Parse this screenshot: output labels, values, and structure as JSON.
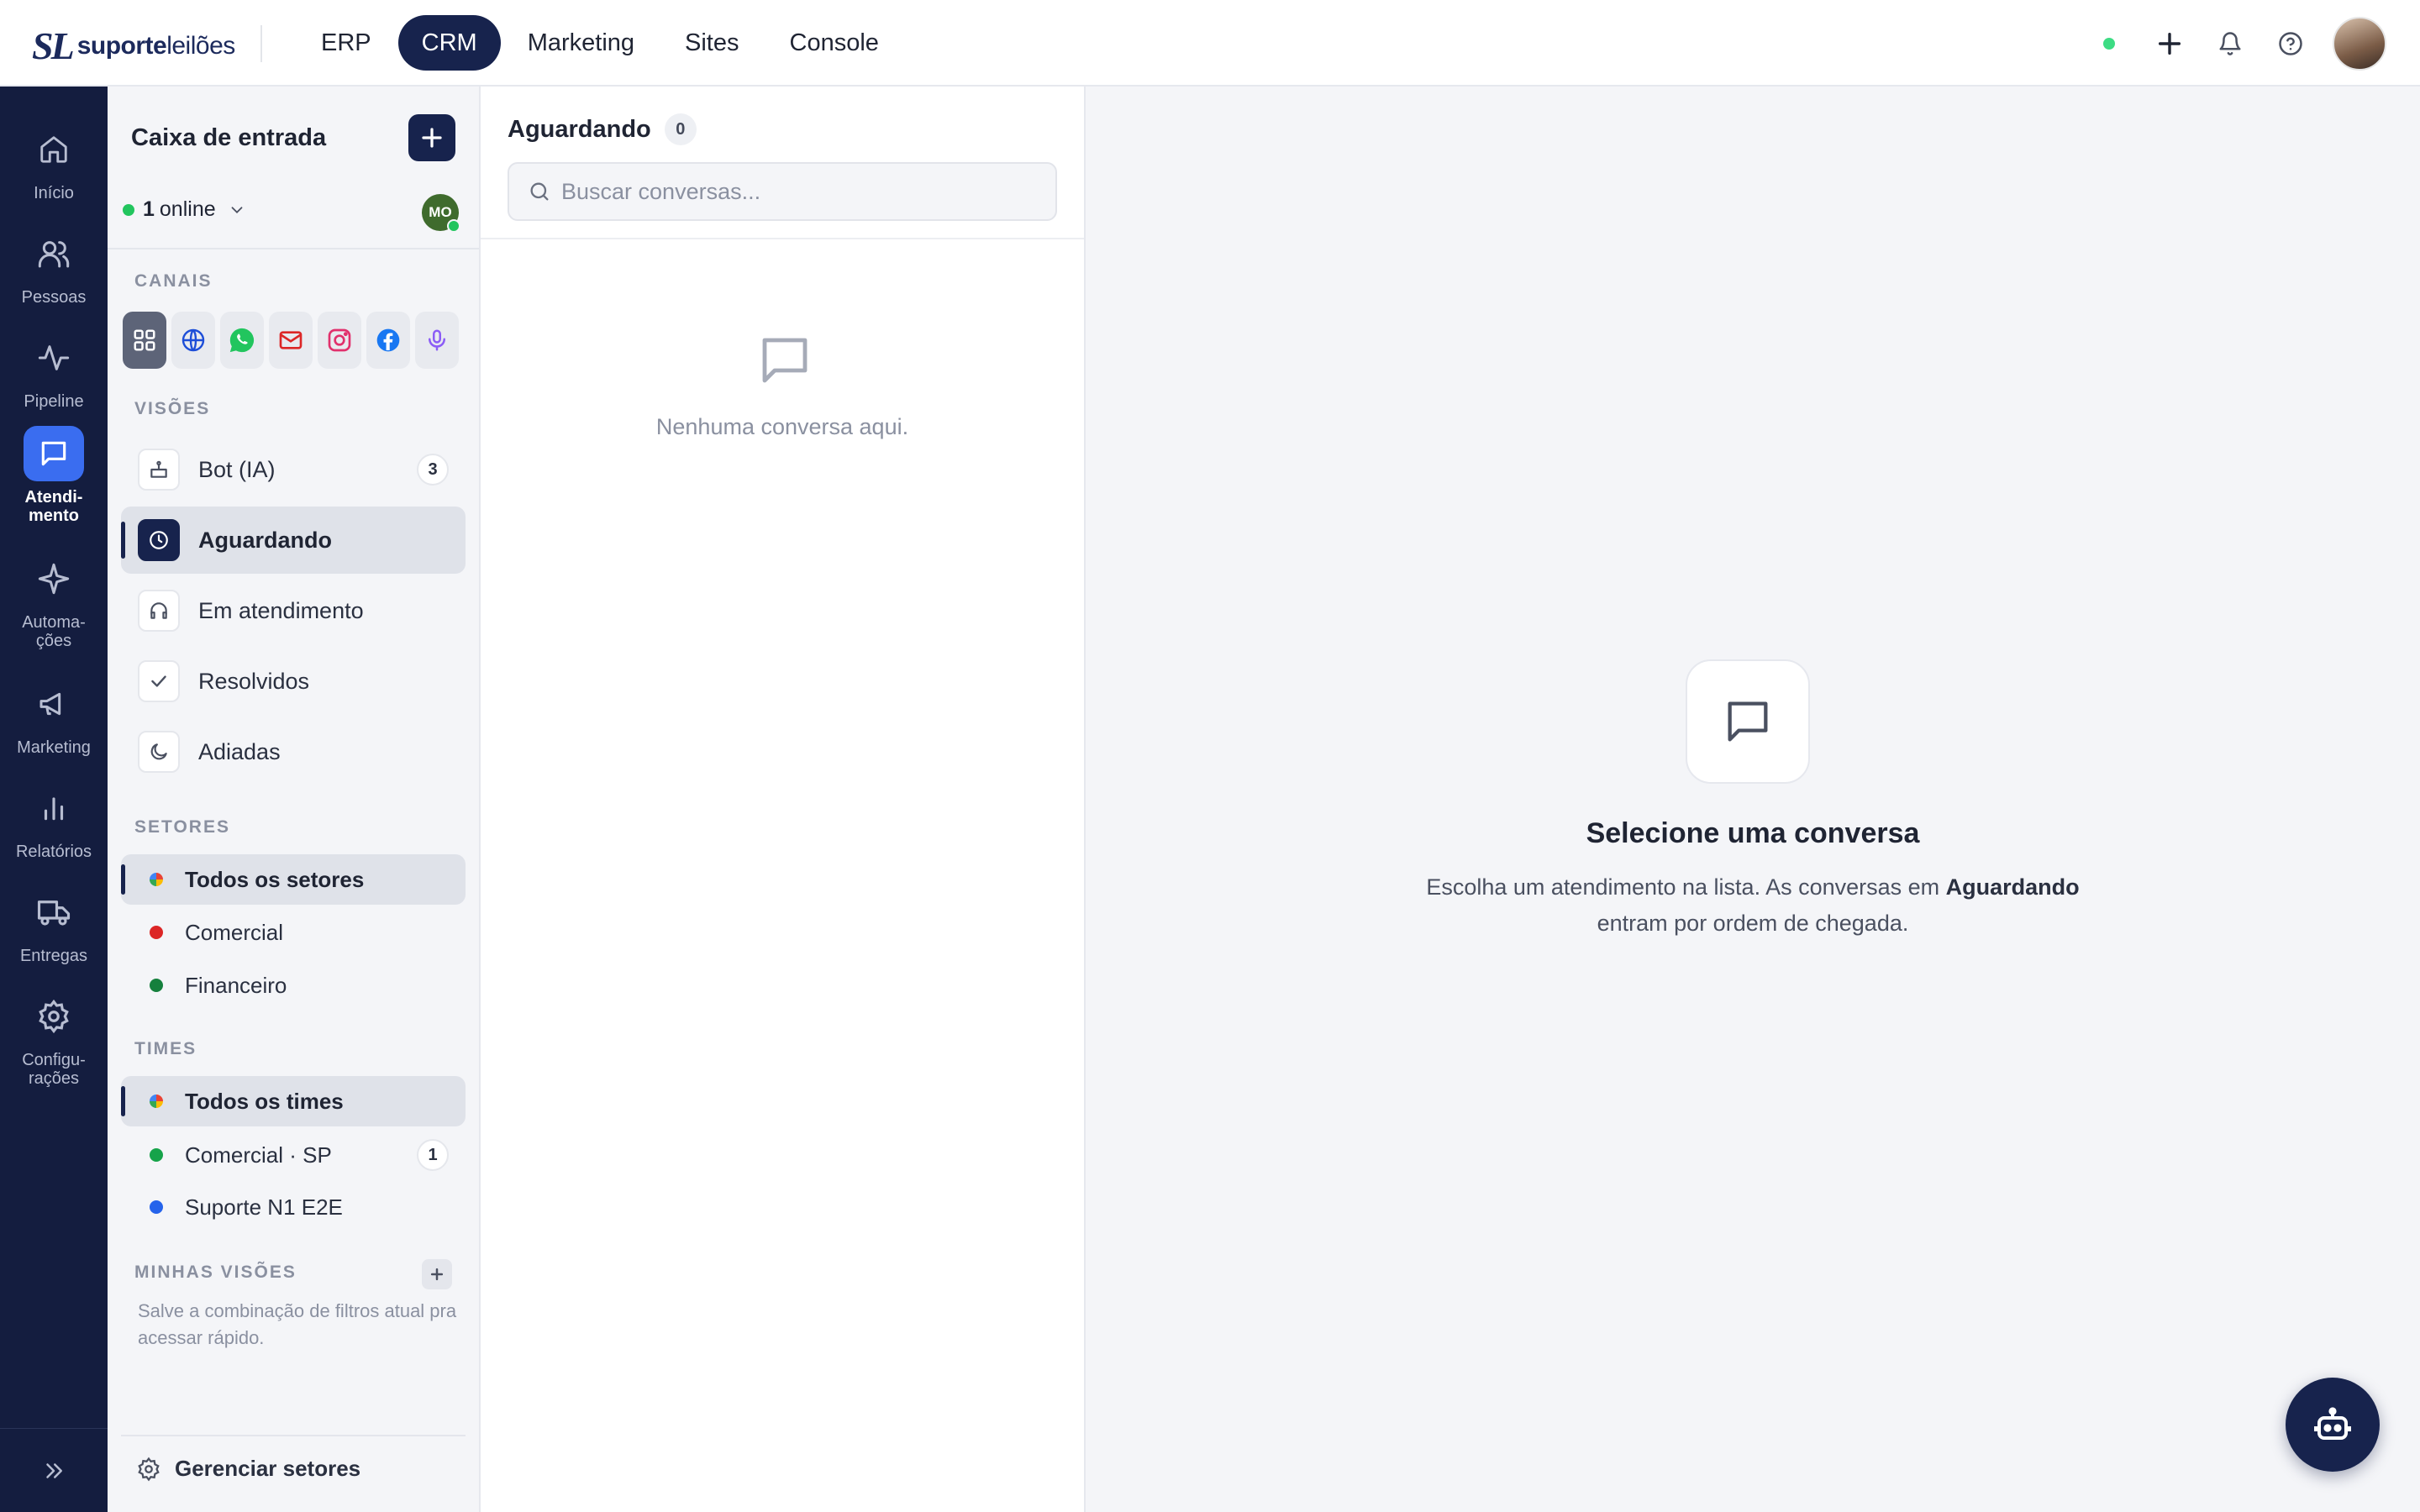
{
  "brand": {
    "mark": "SL",
    "word_bold": "suporte",
    "word_light": "leilões"
  },
  "topnav": [
    {
      "label": "ERP"
    },
    {
      "label": "CRM",
      "active": true
    },
    {
      "label": "Marketing"
    },
    {
      "label": "Sites"
    },
    {
      "label": "Console"
    }
  ],
  "rail": [
    {
      "label": "Início",
      "icon": "home-icon"
    },
    {
      "label": "Pessoas",
      "icon": "users-icon"
    },
    {
      "label": "Pipeline",
      "icon": "activity-icon"
    },
    {
      "label": "Atendi-\nmento",
      "icon": "chat-icon",
      "active": true
    },
    {
      "label": "Automa-\nções",
      "icon": "sparkle-icon"
    },
    {
      "label": "Marketing",
      "icon": "megaphone-icon"
    },
    {
      "label": "Relatórios",
      "icon": "bar-chart-icon"
    },
    {
      "label": "Entregas",
      "icon": "truck-icon"
    },
    {
      "label": "Configu-\nrações",
      "icon": "gear-icon"
    }
  ],
  "sidebar": {
    "title": "Caixa de entrada",
    "online_count": "1",
    "online_label": "online",
    "avatar_initials": "MO",
    "channels_label": "CANAIS",
    "views_label": "VISÕES",
    "views": [
      {
        "label": "Bot (IA)",
        "count": "3"
      },
      {
        "label": "Aguardando",
        "active": true
      },
      {
        "label": "Em atendimento"
      },
      {
        "label": "Resolvidos"
      },
      {
        "label": "Adiadas"
      }
    ],
    "sectors_label": "SETORES",
    "sectors": [
      {
        "label": "Todos os setores",
        "color": "multi",
        "active": true
      },
      {
        "label": "Comercial",
        "color": "#dc2626"
      },
      {
        "label": "Financeiro",
        "color": "#15803d"
      }
    ],
    "teams_label": "TIMES",
    "teams": [
      {
        "label": "Todos os times",
        "color": "multi",
        "active": true
      },
      {
        "label": "Comercial · SP",
        "color": "#16a34a",
        "count": "1"
      },
      {
        "label": "Suporte N1 E2E",
        "color": "#2563eb"
      }
    ],
    "my_views_label": "MINHAS VISÕES",
    "my_views_hint": "Salve a combinação de filtros atual pra acessar rápido.",
    "manage_label": "Gerenciar setores"
  },
  "convlist": {
    "title": "Aguardando",
    "count": "0",
    "search_placeholder": "Buscar conversas...",
    "empty_text": "Nenhuma conversa aqui."
  },
  "detail": {
    "title": "Selecione uma conversa",
    "desc_prefix": "Escolha um atendimento na lista. As conversas em ",
    "desc_bold": "Aguardando",
    "desc_suffix": " entram por ordem de chegada."
  },
  "colors": {
    "navy": "#17234d",
    "rail": "#141d3f",
    "accent": "#3a6df0",
    "online": "#22c55e"
  }
}
